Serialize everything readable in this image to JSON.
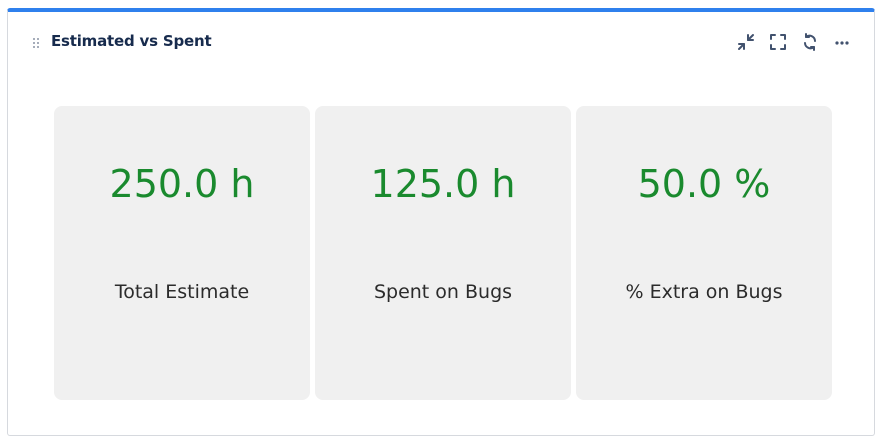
{
  "widget": {
    "title": "Estimated vs Spent",
    "actions": [
      "minimize",
      "fullscreen",
      "refresh",
      "more"
    ]
  },
  "tiles": [
    {
      "value": "250.0 h",
      "label": "Total Estimate"
    },
    {
      "value": "125.0 h",
      "label": "Spent on Bugs"
    },
    {
      "value": "50.0 %",
      "label": "% Extra on Bugs"
    }
  ],
  "colors": {
    "accent": "#2f80ed",
    "value": "#1a8a2e",
    "tile_bg": "#f0f0f0"
  }
}
